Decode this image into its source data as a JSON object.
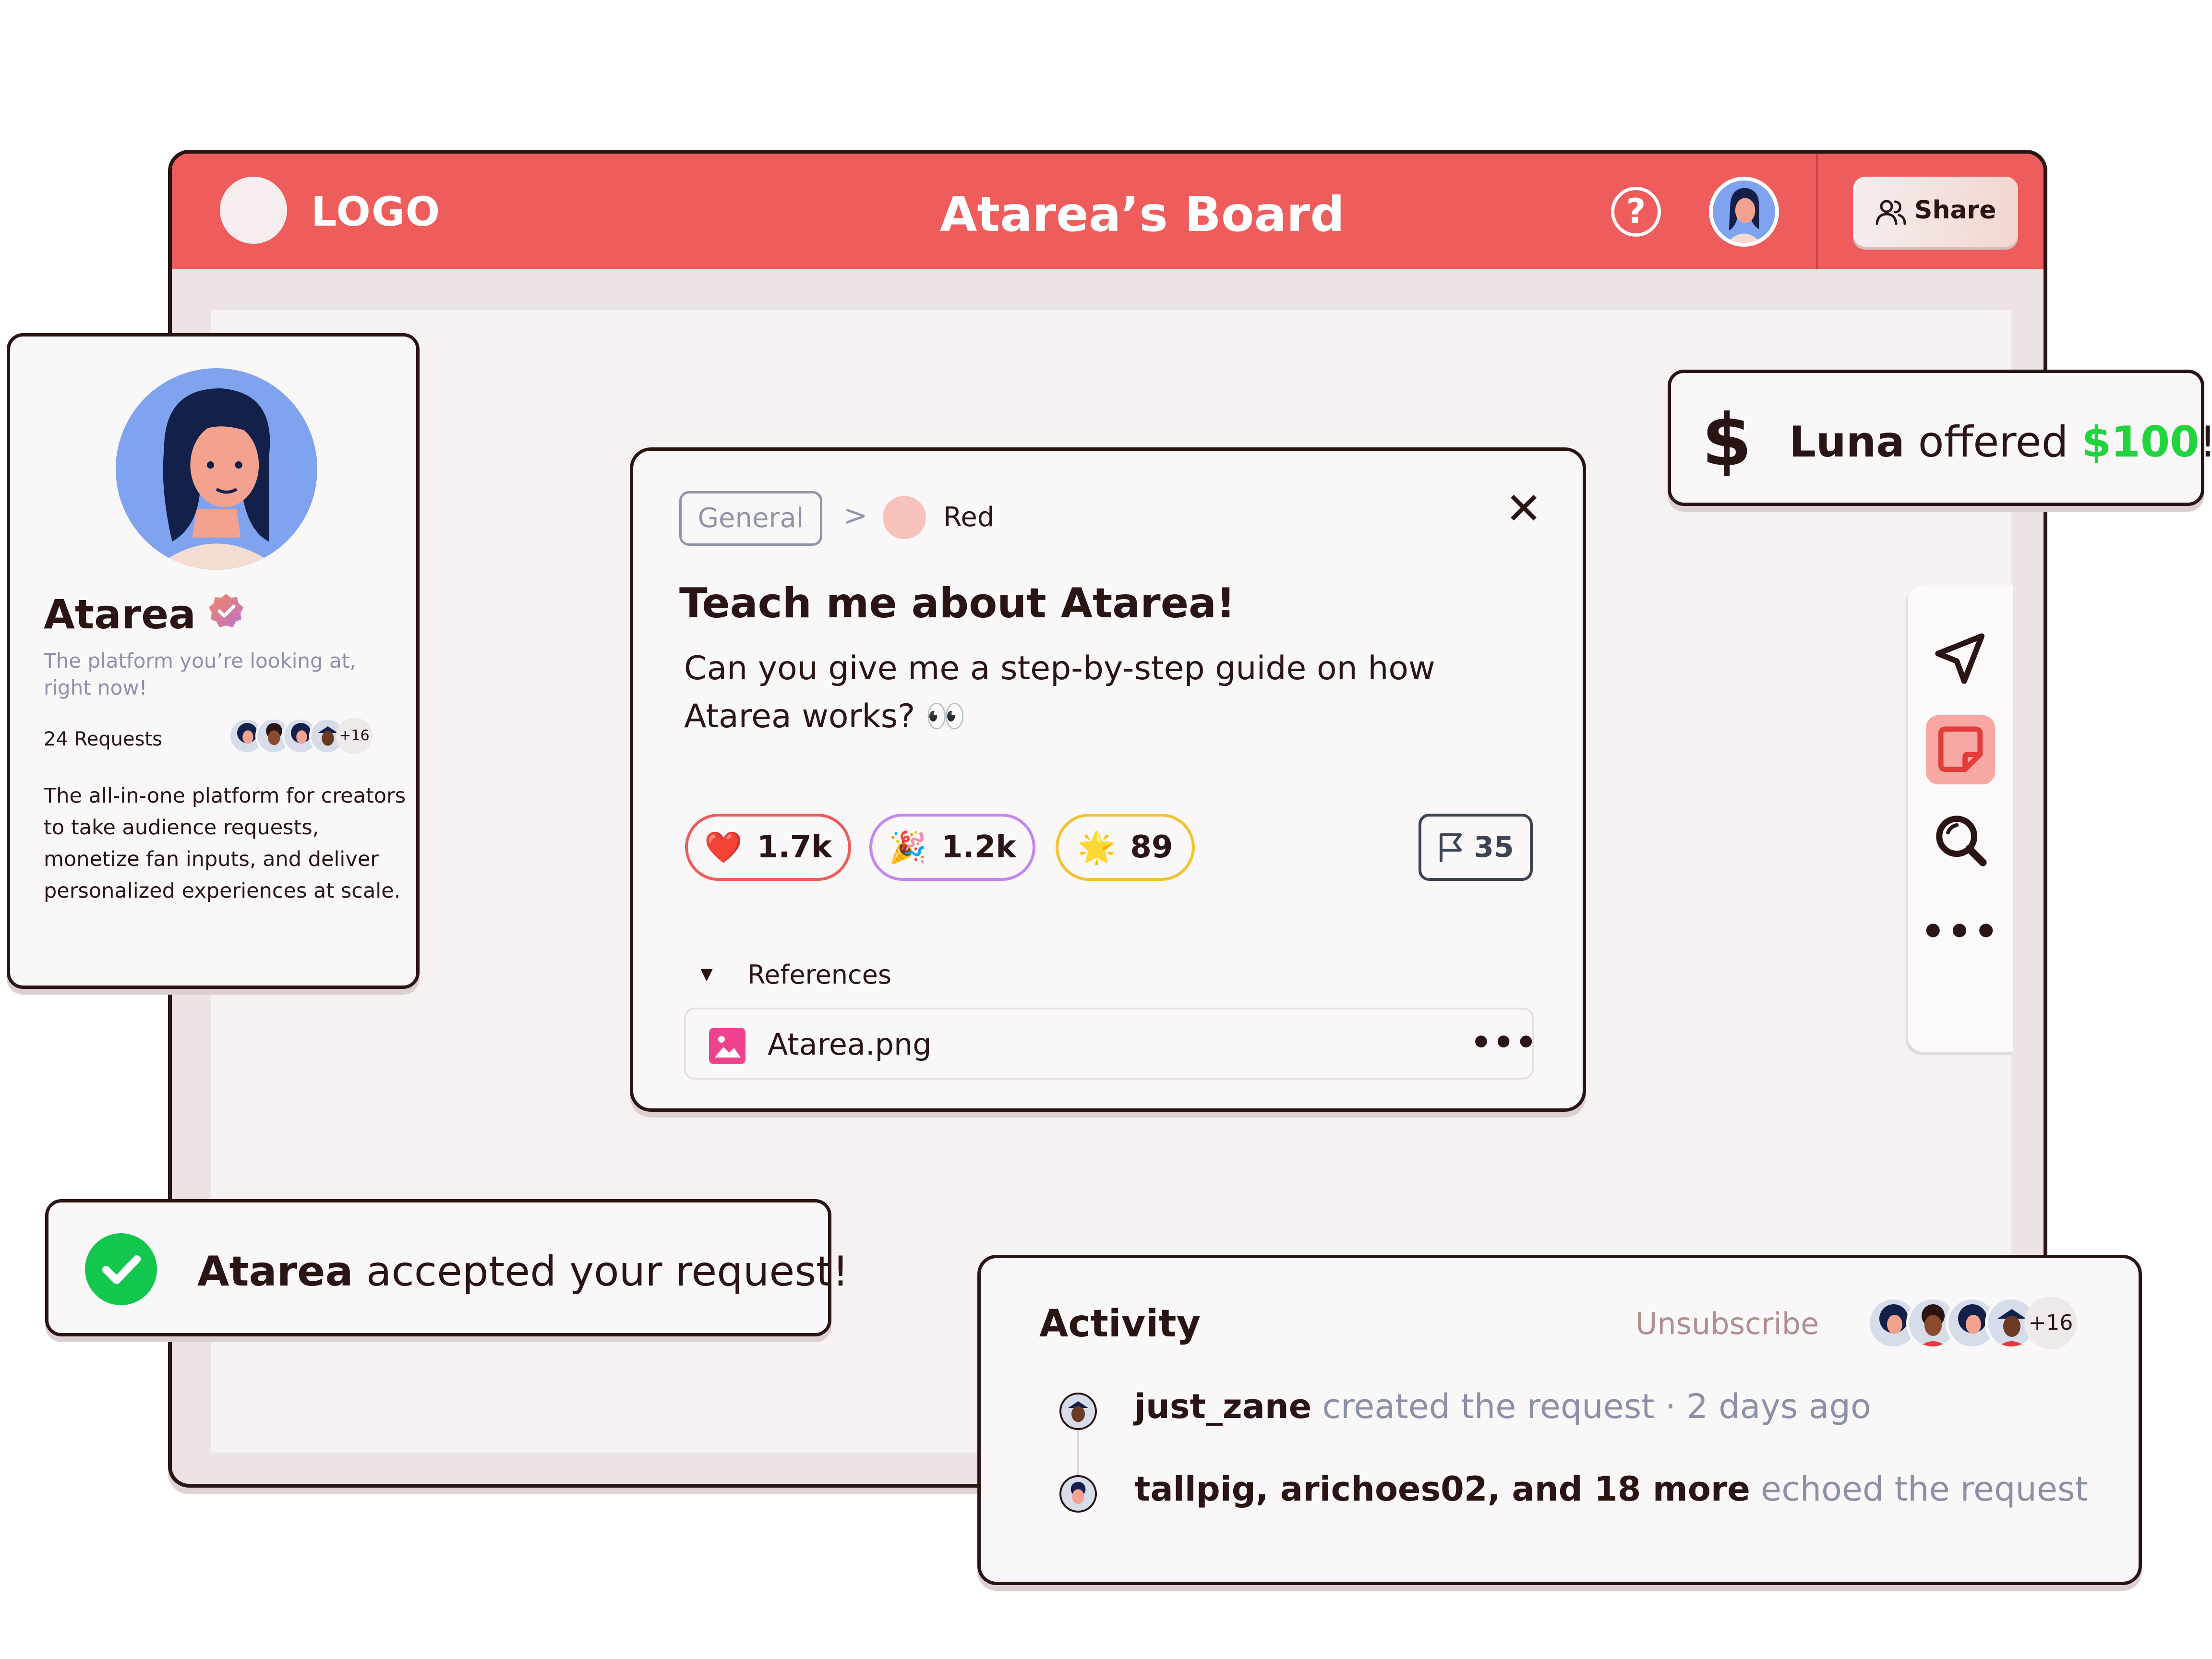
{
  "header": {
    "logo_text": "LOGO",
    "board_title": "Atarea’s Board",
    "help_symbol": "?",
    "share_label": "Share"
  },
  "profile": {
    "name": "Atarea",
    "tagline": "The platform you’re looking at, right now!",
    "requests": "24 Requests",
    "more_count": "+16",
    "description": "The all-in-one platform for creators to take audience requests, monetize fan inputs, and deliver personalized experiences at scale."
  },
  "request": {
    "category": "General",
    "breadcrumb_separator": ">",
    "tag": "Red",
    "close_symbol": "✕",
    "title": "Teach me about Atarea!",
    "body": "Can you give me a step-by-step guide on how Atarea works? 👀",
    "reactions": [
      {
        "emoji": "❤️",
        "count": "1.7k",
        "color": "#ee5c5c"
      },
      {
        "emoji": "🎉",
        "count": "1.2k",
        "color": "#c486f0"
      },
      {
        "emoji": "🌟",
        "count": "89",
        "color": "#f2c232"
      }
    ],
    "flag_count": "35",
    "references_label": "References",
    "references_toggle": "▼",
    "attachment": {
      "name": "Atarea.png",
      "more": "•••"
    }
  },
  "offer": {
    "symbol": "$",
    "name": "Luna",
    "text": " offered ",
    "amount": "$100",
    "suffix": "!"
  },
  "toolbar": {
    "items": [
      "send-icon",
      "sticky-note-icon",
      "search-icon",
      "more-icon"
    ],
    "more_label": "•••"
  },
  "accepted": {
    "name": "Atarea",
    "text": " accepted your request!"
  },
  "activity": {
    "title": "Activity",
    "unsubscribe": "Unsubscribe",
    "more_count": "+16",
    "entries": [
      {
        "actor": "just_zane",
        "action": " created the request",
        "time": " · 2 days ago"
      },
      {
        "actor": "tallpig, arichoes02, and 18 more",
        "action": " echoed the request",
        "time": ""
      }
    ]
  },
  "colors": {
    "brand": "#ee5c5c",
    "ink": "#2a1414",
    "success": "#12c64e",
    "money": "#21d33c"
  }
}
